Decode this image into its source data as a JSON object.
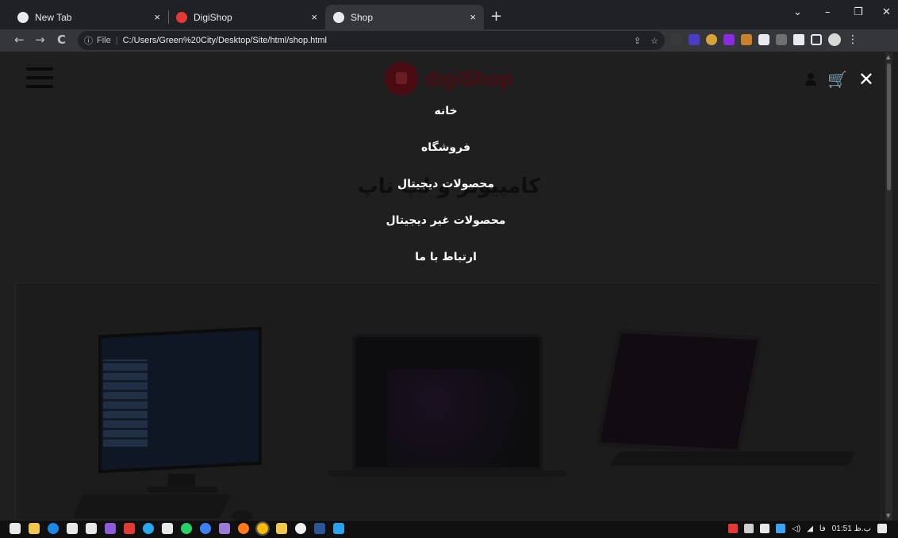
{
  "browser": {
    "tabs": [
      {
        "title": "New Tab",
        "active": false
      },
      {
        "title": "DigiShop",
        "active": false
      },
      {
        "title": "Shop",
        "active": true
      }
    ],
    "close_symbol": "×",
    "new_tab_symbol": "+",
    "window_controls": [
      "⌄",
      "–",
      "❐",
      "✕"
    ],
    "nav": {
      "back": "←",
      "forward": "→",
      "reload": "C"
    },
    "address": {
      "info_icon": "ⓘ",
      "scheme_label": "File",
      "url": "C:/Users/Green%20City/Desktop/Site/html/shop.html"
    },
    "omnibox_actions": [
      "⇪",
      "☆"
    ],
    "menu_symbol": "⋮"
  },
  "site": {
    "logo_text": "digiShop",
    "section_title": "کامپیوتر و لپ تاپ",
    "menu": {
      "items": [
        {
          "label": "خانه"
        },
        {
          "label": "فروشگاه"
        },
        {
          "label": "محصولات دیجیتال"
        },
        {
          "label": "محصولات غیر دیجیتال"
        },
        {
          "label": "ارتباط با ما"
        }
      ],
      "close_symbol": "✕"
    },
    "cart_symbol": "🛒"
  },
  "taskbar": {
    "language": "فا",
    "time": "01:51 ب.ظ"
  },
  "colors": {
    "page_bg": "#1f1f1f",
    "tab_bar": "#202124",
    "toolbar": "#35363a",
    "logo_red": "#4a0c12",
    "menu_text": "#ffffff"
  }
}
